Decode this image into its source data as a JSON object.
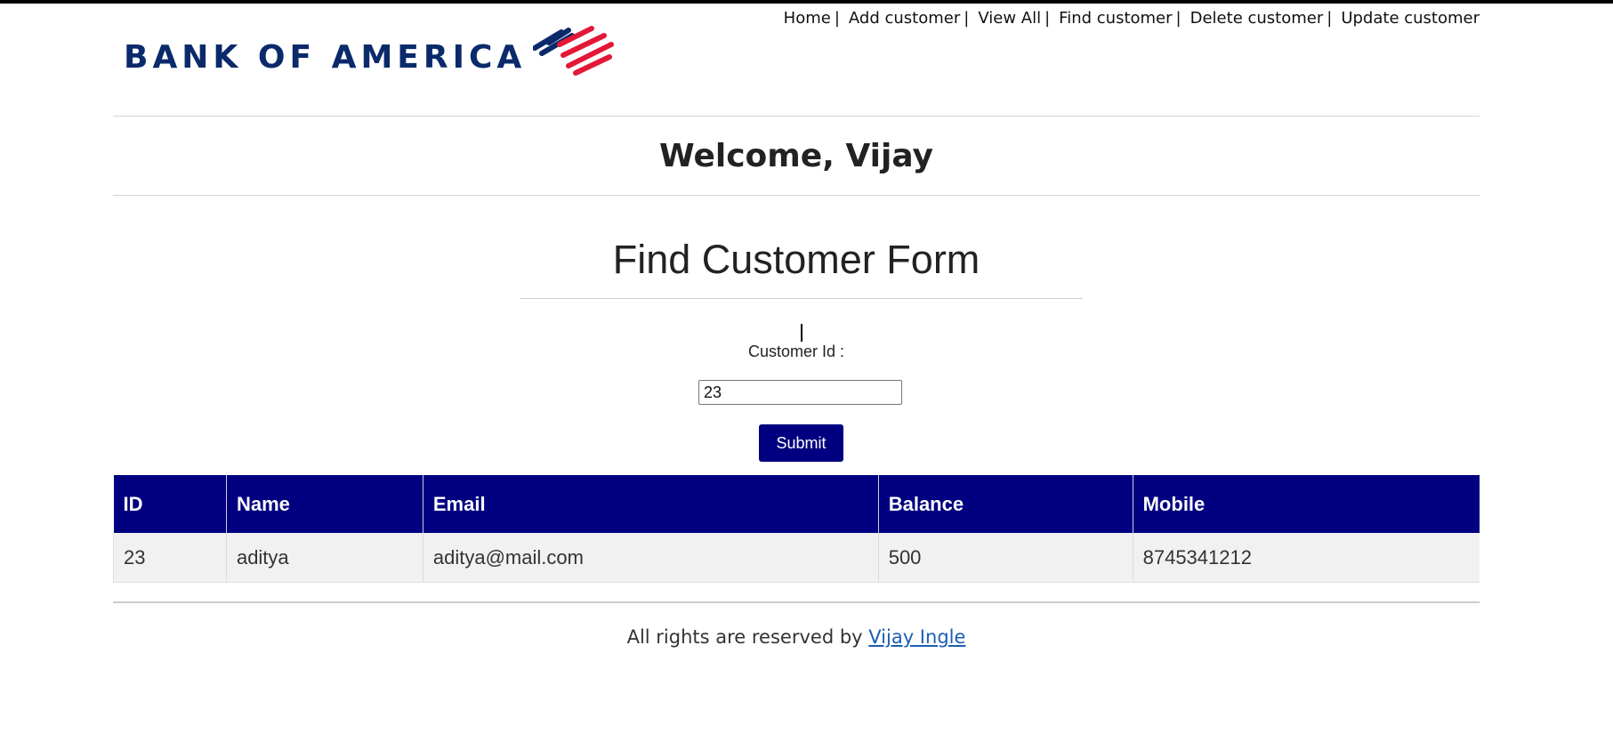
{
  "brand": {
    "name": "BANK OF AMERICA",
    "colors": {
      "navy": "#0a2a6b",
      "red": "#e31837",
      "accent": "#000080"
    }
  },
  "nav": {
    "items": [
      {
        "label": "Home",
        "sep": "|"
      },
      {
        "label": "Add customer",
        "sep": "|"
      },
      {
        "label": "View All",
        "sep": "|"
      },
      {
        "label": "Find customer",
        "sep": "|"
      },
      {
        "label": "Delete customer",
        "sep": "|"
      },
      {
        "label": "Update customer",
        "sep": ""
      }
    ]
  },
  "welcome": {
    "text": "Welcome, Vijay"
  },
  "form": {
    "title": "Find Customer Form",
    "label": "Customer Id :",
    "input_value": "23",
    "submit_label": "Submit"
  },
  "table": {
    "headers": [
      "ID",
      "Name",
      "Email",
      "Balance",
      "Mobile"
    ],
    "rows": [
      [
        "23",
        "aditya",
        "aditya@mail.com",
        "500",
        "8745341212"
      ]
    ]
  },
  "footer": {
    "text": "All rights are reserved by ",
    "link_label": "Vijay Ingle"
  }
}
